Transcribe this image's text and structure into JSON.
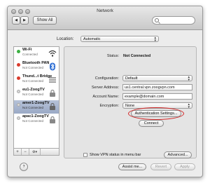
{
  "window": {
    "title": "Network",
    "show_all_label": "Show All",
    "nav_back": "◀",
    "nav_forward": "▶"
  },
  "location": {
    "label": "Location:",
    "value": "Automatic"
  },
  "services": [
    {
      "name": "Wi-Fi",
      "status": "Connected",
      "dot_color": "#3cb043",
      "icon": "wifi-icon"
    },
    {
      "name": "Bluetooth PAN",
      "status": "Not Connected",
      "dot_color": "#d93a2b",
      "icon": "bluetooth-icon"
    },
    {
      "name": "Thund...t Bridge",
      "status": "Not Connected",
      "dot_color": "#d93a2b",
      "icon": "bridge-icon"
    },
    {
      "name": "eu1-ZoogTV",
      "status": "Not Connected",
      "dot_color": "#d8d8d8",
      "icon": "vpn-lock-icon"
    },
    {
      "name": "amer1-ZoogTV",
      "status": "Not Connected",
      "dot_color": "#d8d8d8",
      "icon": "vpn-lock-icon",
      "selected": true
    },
    {
      "name": "apac1-ZoogTV",
      "status": "Not Connected",
      "dot_color": "#d8d8d8",
      "icon": "vpn-lock-icon"
    }
  ],
  "sidebar_footer": {
    "add": "+",
    "remove": "−",
    "gear": "⚙▾"
  },
  "detail": {
    "status_label": "Status:",
    "status_value": "Not Connected",
    "configuration_label": "Configuration:",
    "configuration_value": "Default",
    "server_label": "Server Address:",
    "server_value": "us1.central.vpn.zoogvpn.com",
    "account_label": "Account Name:",
    "account_value": "example@domain.com",
    "encryption_label": "Encryption:",
    "encryption_value": "None",
    "auth_button": "Authentication Settings...",
    "connect_button": "Connect",
    "show_vpn_label": "Show VPN status in menu bar",
    "advanced_button": "Advanced...",
    "help_icon": "?"
  },
  "footer": {
    "assist_button": "Assist me...",
    "revert_button": "Revert",
    "apply_button": "Apply"
  },
  "colors": {
    "highlight": "#d42a2a",
    "selection": "#a6b4ce"
  }
}
